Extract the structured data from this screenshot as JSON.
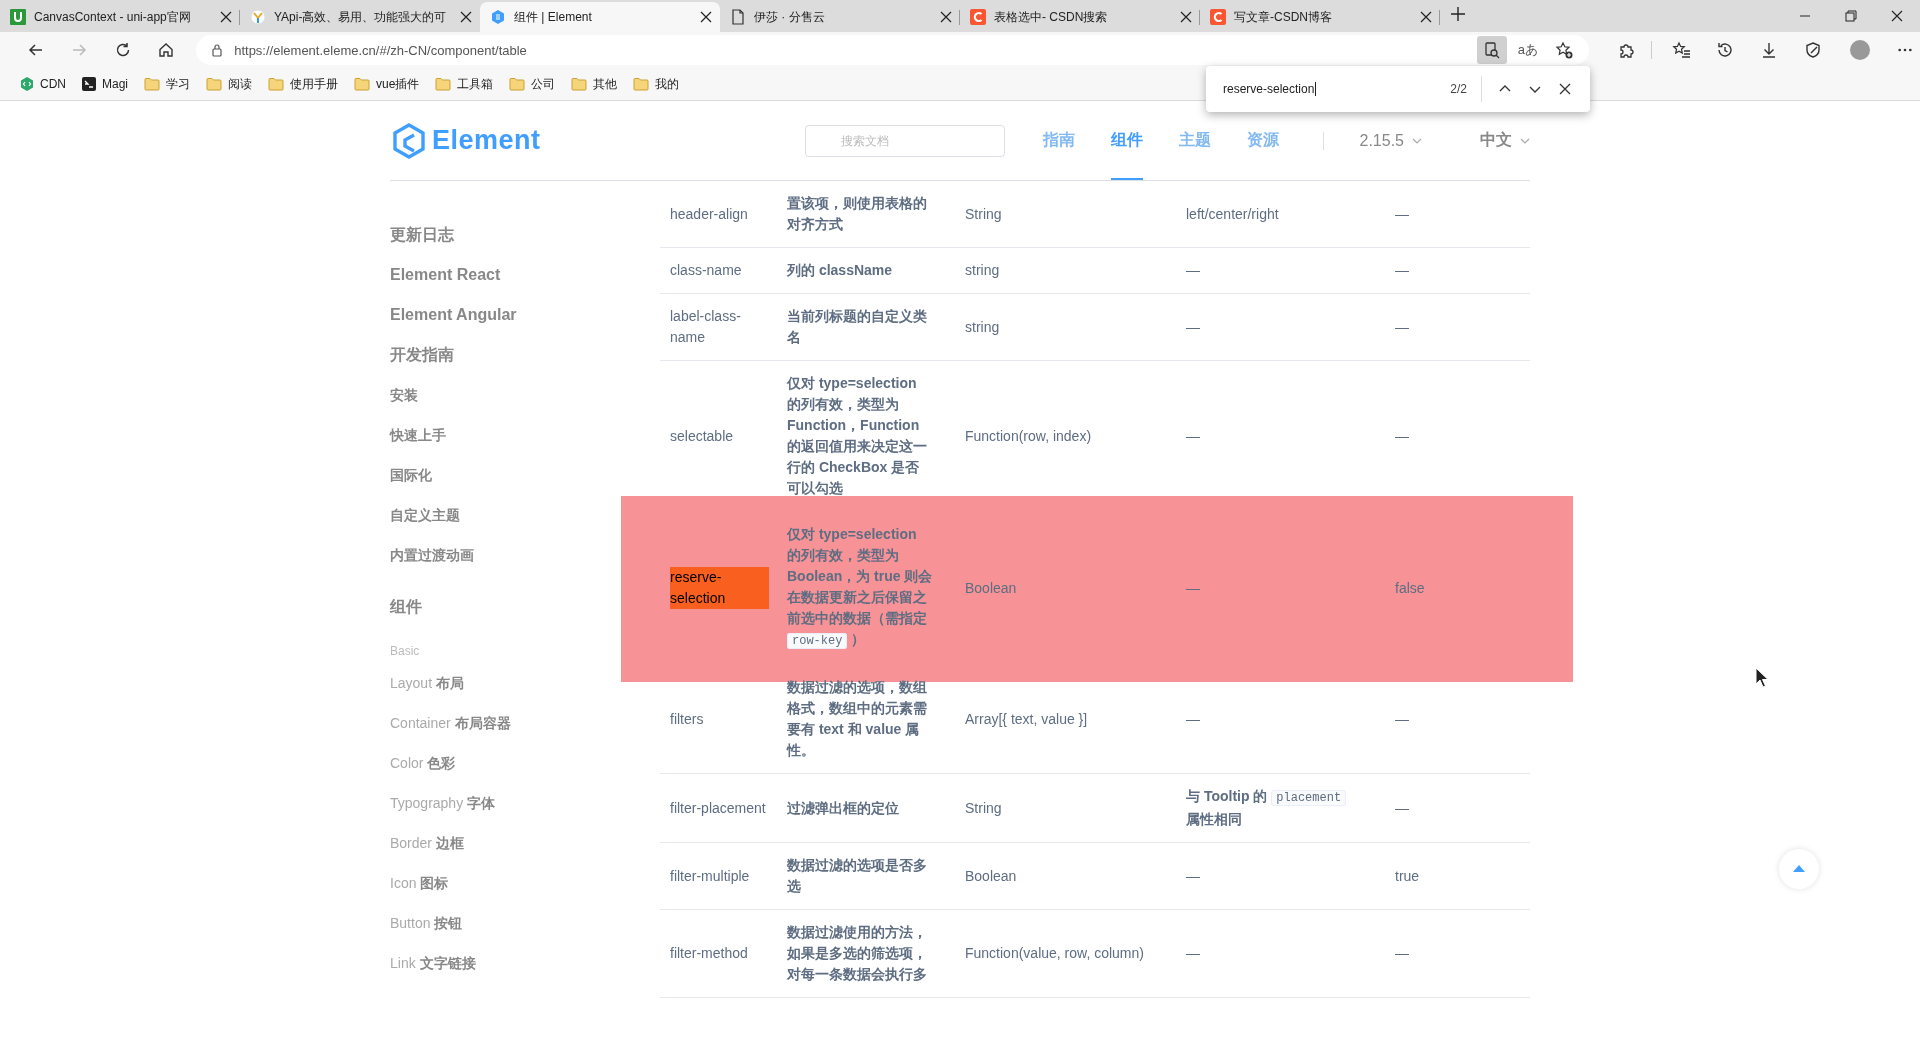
{
  "browser": {
    "tabs": [
      {
        "title": "CanvasContext - uni-app官网",
        "kind": "uniapp",
        "selected": false
      },
      {
        "title": "YApi-高效、易用、功能强大的可",
        "kind": "yapi",
        "selected": false
      },
      {
        "title": "组件 | Element",
        "kind": "element",
        "selected": true
      },
      {
        "title": "伊莎 · 分售云",
        "kind": "document",
        "selected": false
      },
      {
        "title": "表格选中- CSDN搜索",
        "kind": "csdn",
        "selected": false
      },
      {
        "title": "写文章-CSDN博客",
        "kind": "csdn",
        "selected": false
      }
    ],
    "url": "https://element.eleme.cn/#/zh-CN/component/table",
    "read_mode_label": "aあ",
    "bookmarks": [
      {
        "label": "CDN",
        "kind": "hexagon"
      },
      {
        "label": "Magi",
        "kind": "square"
      },
      {
        "label": "学习",
        "kind": "folder"
      },
      {
        "label": "阅读",
        "kind": "folder"
      },
      {
        "label": "使用手册",
        "kind": "folder"
      },
      {
        "label": "vue插件",
        "kind": "folder"
      },
      {
        "label": "工具箱",
        "kind": "folder"
      },
      {
        "label": "公司",
        "kind": "folder"
      },
      {
        "label": "其他",
        "kind": "folder"
      },
      {
        "label": "我的",
        "kind": "folder"
      }
    ]
  },
  "find_bar": {
    "value": "reserve-selection",
    "count": "2/2"
  },
  "site_header": {
    "logo_text": "Element",
    "search": {
      "placeholder": "搜索文档"
    },
    "nav": [
      {
        "label": "指南",
        "selected": false
      },
      {
        "label": "组件",
        "selected": true
      },
      {
        "label": "主题",
        "selected": false
      },
      {
        "label": "资源",
        "selected": false
      }
    ],
    "version": "2.15.5",
    "language": "中文"
  },
  "sidebar": {
    "items": [
      {
        "label": "更新日志",
        "kind": "heading"
      },
      {
        "label": "Element React",
        "kind": "heading"
      },
      {
        "label": "Element Angular",
        "kind": "heading"
      },
      {
        "label": "开发指南",
        "kind": "heading"
      },
      {
        "label": "安装",
        "kind": "link"
      },
      {
        "label": "快速上手",
        "kind": "link"
      },
      {
        "label": "国际化",
        "kind": "link"
      },
      {
        "label": "自定义主题",
        "kind": "link"
      },
      {
        "label": "内置过渡动画",
        "kind": "link"
      },
      {
        "label": "组件",
        "kind": "section"
      },
      {
        "label": "Basic",
        "kind": "group"
      },
      {
        "label": "Layout **布局**",
        "kind": "link-light"
      },
      {
        "label": "Container **布局容器**",
        "kind": "link-light"
      },
      {
        "label": "Color **色彩**",
        "kind": "link-light"
      },
      {
        "label": "Typography **字体**",
        "kind": "link-light"
      },
      {
        "label": "Border **边框**",
        "kind": "link-light"
      },
      {
        "label": "Icon **图标**",
        "kind": "link-light"
      },
      {
        "label": "Button **按钮**",
        "kind": "link-light"
      },
      {
        "label": "Link **文字链接**",
        "kind": "link-light"
      }
    ]
  },
  "table": {
    "rows": [
      {
        "param": "header-align",
        "description": [
          {
            "kind": "text",
            "text": "置该项，则使用表格的对齐方式"
          }
        ],
        "type": "String",
        "options": [
          {
            "kind": "text",
            "text": "left/center/right"
          }
        ],
        "default": "—",
        "highlighted": false,
        "search_match": false
      },
      {
        "param": "class-name",
        "description": [
          {
            "kind": "text",
            "text": "列的 className"
          }
        ],
        "type": "string",
        "options": [
          {
            "kind": "text",
            "text": "—"
          }
        ],
        "default": "—",
        "highlighted": false,
        "search_match": false
      },
      {
        "param": "label-class-name",
        "description": [
          {
            "kind": "text",
            "text": "当前列标题的自定义类名"
          }
        ],
        "type": "string",
        "options": [
          {
            "kind": "text",
            "text": "—"
          }
        ],
        "default": "—",
        "highlighted": false,
        "search_match": false
      },
      {
        "param": "selectable",
        "description": [
          {
            "kind": "text",
            "text": "仅对 type=selection 的列有效，类型为 Function，Function 的返回值用来决定这一行的 CheckBox 是否可以勾选"
          }
        ],
        "type": "Function(row, index)",
        "options": [
          {
            "kind": "text",
            "text": "—"
          }
        ],
        "default": "—",
        "highlighted": false,
        "search_match": false
      },
      {
        "param": "reserve-selection",
        "description": [
          {
            "kind": "text",
            "text": "仅对 type=selection 的列有效，类型为 Boolean，为 true 则会在数据更新之后保留之前选中的数据（需指定 "
          },
          {
            "kind": "code",
            "text": "row-key"
          },
          {
            "kind": "text",
            "text": " ）"
          }
        ],
        "type": "Boolean",
        "options": [
          {
            "kind": "text",
            "text": "—"
          }
        ],
        "default": "false",
        "highlighted": true,
        "search_match": true
      },
      {
        "param": "filters",
        "description": [
          {
            "kind": "text",
            "text": "数据过滤的选项，数组格式，数组中的元素需要有 text 和 value 属性。"
          }
        ],
        "type": "Array[{ text, value }]",
        "options": [
          {
            "kind": "text",
            "text": "—"
          }
        ],
        "default": "—",
        "highlighted": false,
        "search_match": false
      },
      {
        "param": "filter-placement",
        "description": [
          {
            "kind": "text",
            "text": "过滤弹出框的定位"
          }
        ],
        "type": "String",
        "options": [
          {
            "kind": "text",
            "text": "与 Tooltip 的 "
          },
          {
            "kind": "code",
            "text": "placement"
          },
          {
            "kind": "text",
            "text": " 属性相同"
          }
        ],
        "default": "—",
        "highlighted": false,
        "search_match": false
      },
      {
        "param": "filter-multiple",
        "description": [
          {
            "kind": "text",
            "text": "数据过滤的选项是否多选"
          }
        ],
        "type": "Boolean",
        "options": [
          {
            "kind": "text",
            "text": "—"
          }
        ],
        "default": "true",
        "highlighted": false,
        "search_match": false
      },
      {
        "param": "filter-method",
        "description": [
          {
            "kind": "text",
            "text": "数据过滤使用的方法，如果是多选的筛选项，对每一条数据会执行多"
          }
        ],
        "type": "Function(value, row, column)",
        "options": [
          {
            "kind": "text",
            "text": "—"
          }
        ],
        "default": "—",
        "highlighted": false,
        "search_match": false
      }
    ]
  }
}
